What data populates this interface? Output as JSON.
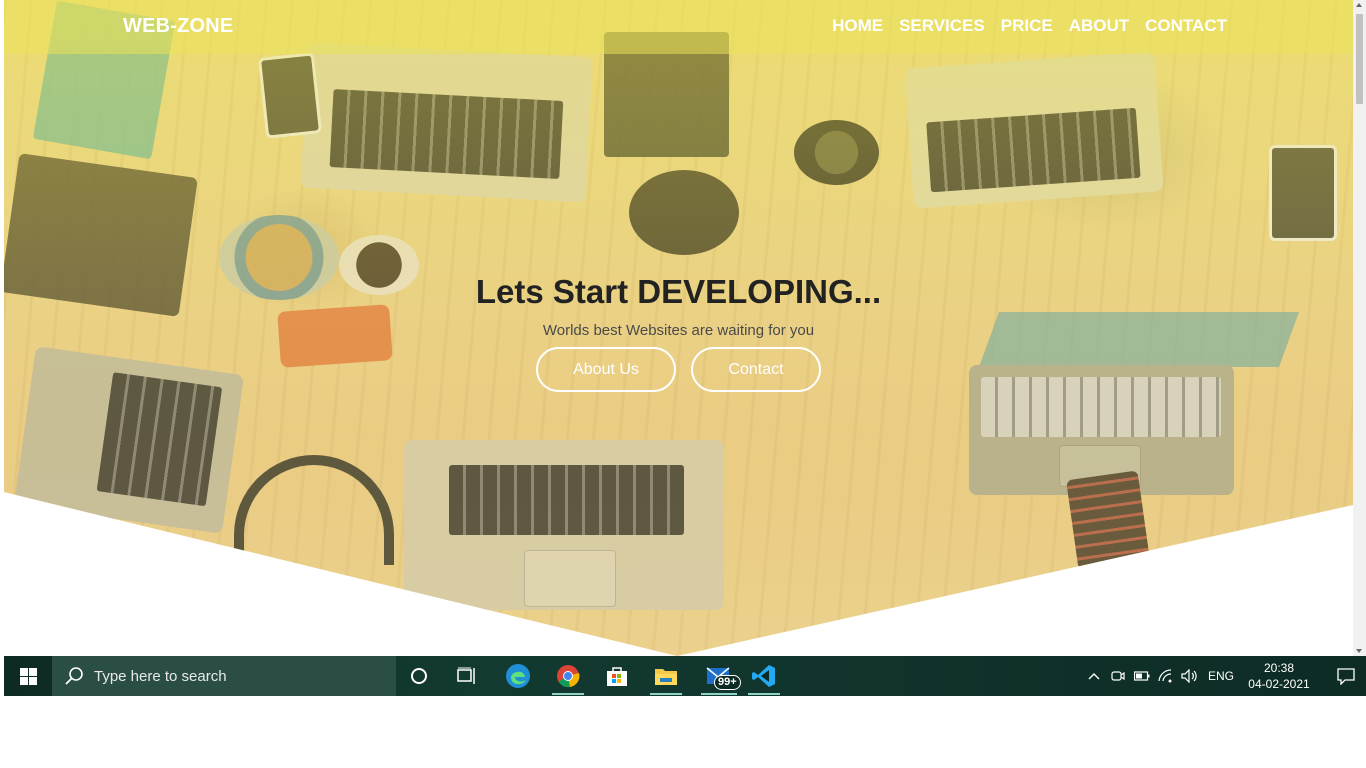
{
  "site": {
    "brand": "WEB-ZONE",
    "nav": [
      "HOME",
      "SERVICES",
      "PRICE",
      "ABOUT",
      "CONTACT"
    ],
    "hero": {
      "title": "Lets Start DEVELOPING...",
      "subtitle": "Worlds best Websites are waiting for you",
      "buttons": [
        "About Us",
        "Contact"
      ]
    },
    "colors": {
      "tint": "#ebe15a",
      "text_dark": "#222222",
      "button_border": "#ffffff"
    }
  },
  "taskbar": {
    "search_placeholder": "Type here to search",
    "apps": [
      "cortana-icon",
      "task-view-icon",
      "edge-icon",
      "chrome-icon",
      "store-icon",
      "file-explorer-icon",
      "mail-icon",
      "vscode-icon"
    ],
    "mail_badge": "99+",
    "language": "ENG",
    "time": "20:38",
    "date": "04-02-2021"
  }
}
